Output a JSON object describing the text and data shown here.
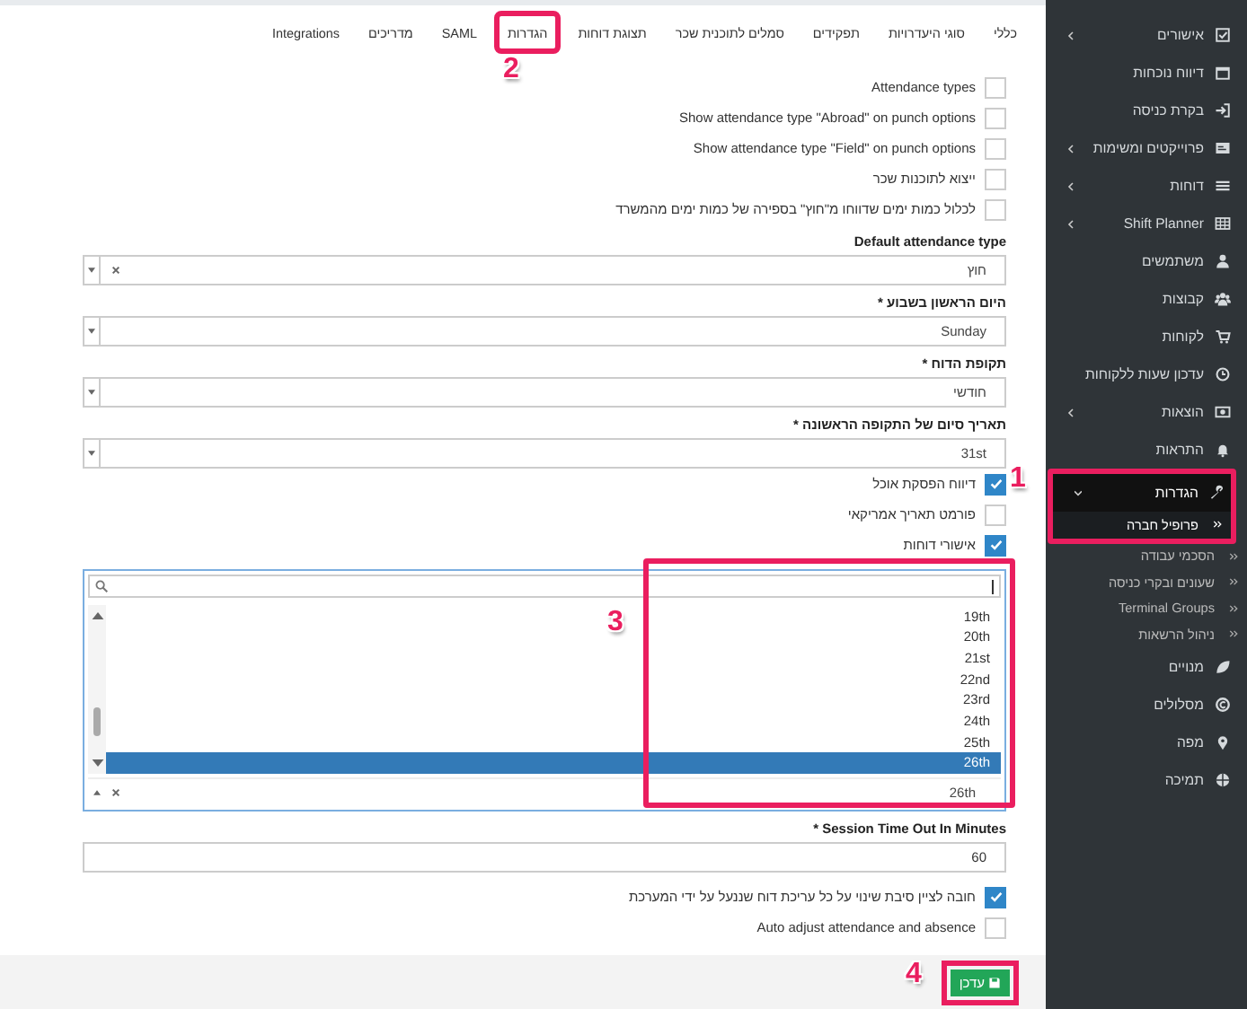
{
  "tabs": [
    {
      "label": "כללי"
    },
    {
      "label": "סוגי היעדרויות"
    },
    {
      "label": "תפקידים"
    },
    {
      "label": "סמלים לתוכנית שכר"
    },
    {
      "label": "תצוגת דוחות"
    },
    {
      "label": "הגדרות"
    },
    {
      "label": "SAML"
    },
    {
      "label": "מדריכים"
    },
    {
      "label": "Integrations"
    }
  ],
  "form": [
    {
      "kind": "checkbox",
      "label": "Attendance types",
      "checked": false
    },
    {
      "kind": "checkbox",
      "label": "Show attendance type \"Abroad\" on punch options",
      "checked": false
    },
    {
      "kind": "checkbox",
      "label": "Show attendance type \"Field\" on punch options",
      "checked": false
    },
    {
      "kind": "checkbox",
      "label": "ייצוא לתוכנות שכר",
      "checked": false
    },
    {
      "kind": "checkbox",
      "label": "לכלול כמות ימים שדווחו מ\"חוץ\" בספירה של כמות ימים מהמשרד",
      "checked": false
    },
    {
      "kind": "select",
      "label": "Default attendance type",
      "value": "חוץ",
      "clearable": true
    },
    {
      "kind": "select",
      "label": "היום הראשון בשבוע *",
      "value": "Sunday",
      "clearable": false
    },
    {
      "kind": "select",
      "label": "תקופת הדוח *",
      "value": "חודשי",
      "clearable": false
    },
    {
      "kind": "select",
      "label": "תאריך סיום של התקופה הראשונה *",
      "value": "31st",
      "clearable": false
    },
    {
      "kind": "checkbox",
      "label": "דיווח הפסקת אוכל",
      "checked": true
    },
    {
      "kind": "checkbox",
      "label": "פורמט תאריך אמריקאי",
      "checked": false
    },
    {
      "kind": "checkbox",
      "label": "אישורי דוחות",
      "checked": true
    },
    {
      "kind": "dropdown",
      "value": "26th",
      "clearable": true,
      "options": [
        {
          "label": "19th",
          "selected": false
        },
        {
          "label": "20th",
          "selected": false
        },
        {
          "label": "21st",
          "selected": false
        },
        {
          "label": "22nd",
          "selected": false
        },
        {
          "label": "23rd",
          "selected": false
        },
        {
          "label": "24th",
          "selected": false
        },
        {
          "label": "25th",
          "selected": false
        },
        {
          "label": "26th",
          "selected": true
        }
      ]
    },
    {
      "kind": "input",
      "label": "Session Time Out In Minutes *",
      "value": "60"
    },
    {
      "kind": "checkbox",
      "label": "חובה לציין סיבת שינוי על כל עריכת דוח שננעל על ידי המערכת",
      "checked": true
    },
    {
      "kind": "checkbox",
      "label": "Auto adjust attendance and absence",
      "checked": false
    }
  ],
  "save_button": "עדכן",
  "sidebar": {
    "items": [
      {
        "label": "אישורים",
        "has_children": true,
        "selected": false
      },
      {
        "label": "דיווח נוכחות",
        "has_children": false,
        "selected": false
      },
      {
        "label": "בקרת כניסה",
        "has_children": false,
        "selected": false
      },
      {
        "label": "פרוייקטים ומשימות",
        "has_children": true,
        "selected": false
      },
      {
        "label": "דוחות",
        "has_children": true,
        "selected": false
      },
      {
        "label": "Shift Planner",
        "has_children": true,
        "selected": false
      },
      {
        "label": "משתמשים",
        "has_children": false,
        "selected": false
      },
      {
        "label": "קבוצות",
        "has_children": false,
        "selected": false
      },
      {
        "label": "לקוחות",
        "has_children": false,
        "selected": false
      },
      {
        "label": "עדכון שעות ללקוחות",
        "has_children": false,
        "selected": false
      },
      {
        "label": "הוצאות",
        "has_children": true,
        "selected": false
      },
      {
        "label": "התראות",
        "has_children": false,
        "selected": false
      },
      {
        "label": "הגדרות",
        "has_children": true,
        "selected": true,
        "expanded": true,
        "children": [
          {
            "label": "פרופיל חברה",
            "selected": true
          },
          {
            "label": "הסכמי עבודה",
            "selected": false
          },
          {
            "label": "שעונים ובקרי כניסה",
            "selected": false
          },
          {
            "label": "Terminal Groups",
            "selected": false
          },
          {
            "label": "ניהול הרשאות",
            "selected": false
          }
        ]
      },
      {
        "label": "מנויים",
        "has_children": false,
        "selected": false
      },
      {
        "label": "מסלולים",
        "has_children": false,
        "selected": false
      },
      {
        "label": "מפה",
        "has_children": false,
        "selected": false
      },
      {
        "label": "תמיכה",
        "has_children": false,
        "selected": false
      }
    ]
  },
  "annotations": [
    {
      "number": "1"
    },
    {
      "number": "2"
    },
    {
      "number": "3"
    },
    {
      "number": "4"
    }
  ]
}
